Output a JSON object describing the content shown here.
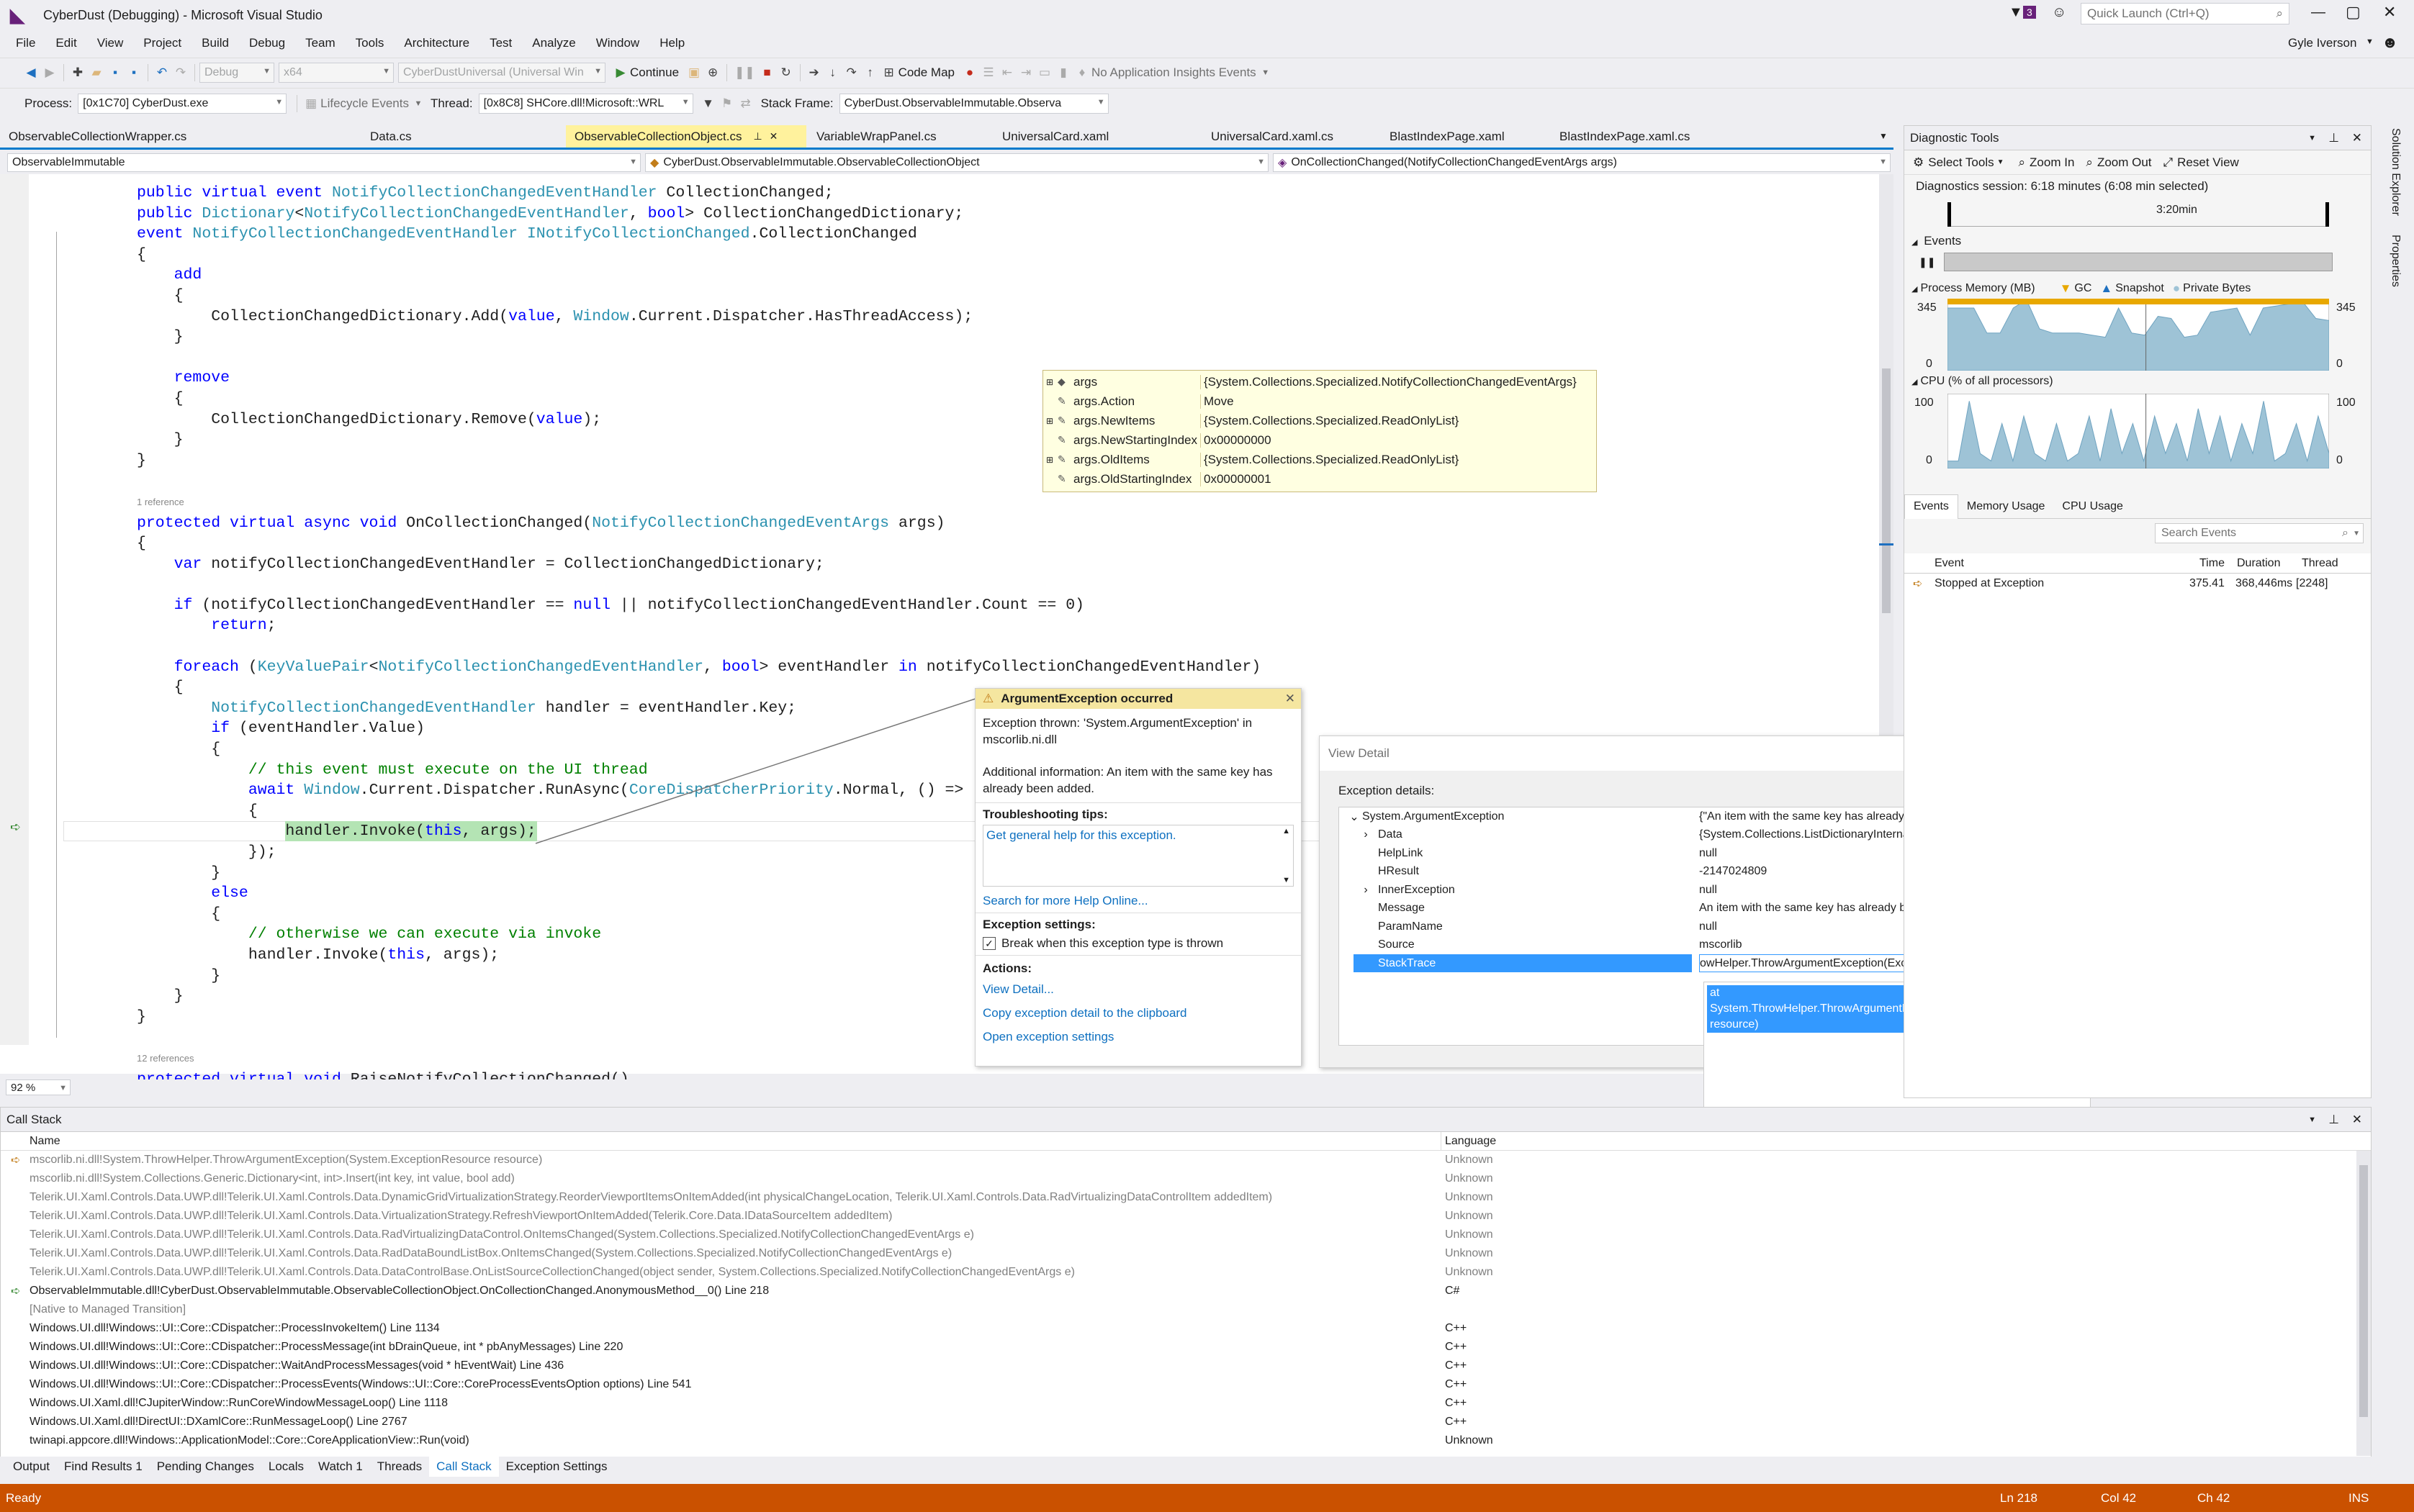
{
  "window": {
    "title": "CyberDust (Debugging) - Microsoft Visual Studio",
    "notifications": "3",
    "quick_launch": "Quick Launch (Ctrl+Q)",
    "user": "Gyle Iverson"
  },
  "menu": [
    "File",
    "Edit",
    "View",
    "Project",
    "Build",
    "Debug",
    "Team",
    "Tools",
    "Architecture",
    "Test",
    "Analyze",
    "Window",
    "Help"
  ],
  "toolbar": {
    "config": "Debug",
    "platform": "x64",
    "startup": "CyberDustUniversal (Universal Win",
    "continue": "Continue",
    "codemap": "Code Map",
    "insights": "No Application Insights Events"
  },
  "debug_location": {
    "process_label": "Process:",
    "process": "[0x1C70] CyberDust.exe",
    "lifecycle": "Lifecycle Events",
    "thread_label": "Thread:",
    "thread": "[0x8C8] SHCore.dll!Microsoft::WRL",
    "stack_label": "Stack Frame:",
    "stack": "CyberDust.ObservableImmutable.Observa"
  },
  "tabs": [
    "ObservableCollectionWrapper.cs",
    "Data.cs",
    "ObservableCollectionObject.cs",
    "VariableWrapPanel.cs",
    "UniversalCard.xaml",
    "UniversalCard.xaml.cs",
    "BlastIndexPage.xaml",
    "BlastIndexPage.xaml.cs"
  ],
  "nav": {
    "project": "ObservableImmutable",
    "type": "CyberDust.ObservableImmutable.ObservableCollectionObject",
    "member": "OnCollectionChanged(NotifyCollectionChangedEventArgs args)"
  },
  "editor": {
    "zoom": "92 %",
    "ref1": "1 reference",
    "ref2": "12 references"
  },
  "datatip": [
    {
      "name": "args",
      "value": "{System.Collections.Specialized.NotifyCollectionChangedEventArgs}"
    },
    {
      "name": "args.Action",
      "value": "Move"
    },
    {
      "name": "args.NewItems",
      "value": "{System.Collections.Specialized.ReadOnlyList}"
    },
    {
      "name": "args.NewStartingIndex",
      "value": "0x00000000"
    },
    {
      "name": "args.OldItems",
      "value": "{System.Collections.Specialized.ReadOnlyList}"
    },
    {
      "name": "args.OldStartingIndex",
      "value": "0x00000001"
    }
  ],
  "exception": {
    "title": "ArgumentException occurred",
    "thrown": "Exception thrown: 'System.ArgumentException' in mscorlib.ni.dll",
    "info": "Additional information: An item with the same key has already been added.",
    "tips_title": "Troubleshooting tips:",
    "tip": "Get general help for this exception.",
    "search": "Search for more Help Online...",
    "settings_title": "Exception settings:",
    "break_when": "Break when this exception type is thrown",
    "actions_title": "Actions:",
    "view_detail": "View Detail...",
    "copy": "Copy exception detail to the clipboard",
    "open_settings": "Open exception settings"
  },
  "view_detail": {
    "title": "View Detail",
    "help": "?",
    "close": "✕",
    "label": "Exception details:",
    "rows": [
      {
        "name": "System.ArgumentException",
        "value": "{\"An item with the same key has already been added.\"}"
      },
      {
        "name": "Data",
        "value": "{System.Collections.ListDictionaryInternal}"
      },
      {
        "name": "HelpLink",
        "value": "null"
      },
      {
        "name": "HResult",
        "value": "-2147024809"
      },
      {
        "name": "InnerException",
        "value": "null"
      },
      {
        "name": "Message",
        "value": "An item with the same key has already been added."
      },
      {
        "name": "ParamName",
        "value": "null"
      },
      {
        "name": "Source",
        "value": "mscorlib"
      },
      {
        "name": "StackTrace",
        "value": "owHelper.ThrowArgumentException(ExceptionResource resource)"
      }
    ],
    "stacktrace_popup": "   at System.ThrowHelper.ThrowArgumentException(ExceptionResource resource)"
  },
  "diag": {
    "title": "Diagnostic Tools",
    "select_tools": "Select Tools",
    "zoom_in": "Zoom In",
    "zoom_out": "Zoom Out",
    "reset_view": "Reset View",
    "session": "Diagnostics session: 6:18 minutes (6:08 min selected)",
    "ruler": "3:20min",
    "events": "Events",
    "memory": "Process Memory (MB)",
    "gc": "GC",
    "snapshot": "Snapshot",
    "private": "Private Bytes",
    "mem_max": "345",
    "mem_min": "0",
    "cpu": "CPU (% of all processors)",
    "cpu_max": "100",
    "cpu_min": "0",
    "tabs": [
      "Events",
      "Memory Usage",
      "CPU Usage"
    ],
    "search": "Search Events",
    "cols": [
      "Event",
      "Time",
      "Duration",
      "Thread"
    ],
    "event": {
      "name": "Stopped at Exception",
      "time": "375.41",
      "duration": "368,446ms",
      "thread": "[2248]"
    },
    "memory_series": [
      300,
      300,
      300,
      180,
      180,
      300,
      340,
      200,
      180,
      180,
      180,
      170,
      160,
      300,
      180,
      170,
      260,
      250,
      160,
      170,
      280,
      290,
      300,
      170,
      300,
      310,
      320,
      330,
      250,
      240
    ],
    "cpu_series": [
      10,
      10,
      90,
      20,
      10,
      60,
      10,
      70,
      20,
      10,
      60,
      10,
      20,
      70,
      10,
      80,
      20,
      60,
      10,
      70,
      20,
      60,
      10,
      80,
      20,
      70,
      10,
      60,
      20,
      90,
      10,
      20,
      60,
      10,
      70,
      20
    ]
  },
  "callstack": {
    "title": "Call Stack",
    "col_name": "Name",
    "col_lang": "Language",
    "rows": [
      {
        "name": "mscorlib.ni.dll!System.ThrowHelper.ThrowArgumentException(System.ExceptionResource resource)",
        "lang": "Unknown",
        "gray": true
      },
      {
        "name": "mscorlib.ni.dll!System.Collections.Generic.Dictionary<int, int>.Insert(int key, int value, bool add)",
        "lang": "Unknown",
        "gray": true
      },
      {
        "name": "Telerik.UI.Xaml.Controls.Data.UWP.dll!Telerik.UI.Xaml.Controls.Data.DynamicGridVirtualizationStrategy.ReorderViewportItemsOnItemAdded(int physicalChangeLocation, Telerik.UI.Xaml.Controls.Data.RadVirtualizingDataControlItem addedItem)",
        "lang": "Unknown",
        "gray": true
      },
      {
        "name": "Telerik.UI.Xaml.Controls.Data.UWP.dll!Telerik.UI.Xaml.Controls.Data.VirtualizationStrategy.RefreshViewportOnItemAdded(Telerik.Core.Data.IDataSourceItem addedItem)",
        "lang": "Unknown",
        "gray": true
      },
      {
        "name": "Telerik.UI.Xaml.Controls.Data.UWP.dll!Telerik.UI.Xaml.Controls.Data.RadVirtualizingDataControl.OnItemsChanged(System.Collections.Specialized.NotifyCollectionChangedEventArgs e)",
        "lang": "Unknown",
        "gray": true
      },
      {
        "name": "Telerik.UI.Xaml.Controls.Data.UWP.dll!Telerik.UI.Xaml.Controls.Data.RadDataBoundListBox.OnItemsChanged(System.Collections.Specialized.NotifyCollectionChangedEventArgs e)",
        "lang": "Unknown",
        "gray": true
      },
      {
        "name": "Telerik.UI.Xaml.Controls.Data.UWP.dll!Telerik.UI.Xaml.Controls.Data.DataControlBase.OnListSourceCollectionChanged(object sender, System.Collections.Specialized.NotifyCollectionChangedEventArgs e)",
        "lang": "Unknown",
        "gray": true
      },
      {
        "name": "ObservableImmutable.dll!CyberDust.ObservableImmutable.ObservableCollectionObject.OnCollectionChanged.AnonymousMethod__0() Line 218",
        "lang": "C#",
        "gray": false
      },
      {
        "name": "[Native to Managed Transition]",
        "lang": "",
        "gray": true
      },
      {
        "name": "Windows.UI.dll!Windows::UI::Core::CDispatcher::ProcessInvokeItem() Line 1134",
        "lang": "C++",
        "gray": false
      },
      {
        "name": "Windows.UI.dll!Windows::UI::Core::CDispatcher::ProcessMessage(int bDrainQueue, int * pbAnyMessages) Line 220",
        "lang": "C++",
        "gray": false
      },
      {
        "name": "Windows.UI.dll!Windows::UI::Core::CDispatcher::WaitAndProcessMessages(void * hEventWait) Line 436",
        "lang": "C++",
        "gray": false
      },
      {
        "name": "Windows.UI.dll!Windows::UI::Core::CDispatcher::ProcessEvents(Windows::UI::Core::CoreProcessEventsOption options) Line 541",
        "lang": "C++",
        "gray": false
      },
      {
        "name": "Windows.UI.Xaml.dll!CJupiterWindow::RunCoreWindowMessageLoop() Line 1118",
        "lang": "C++",
        "gray": false
      },
      {
        "name": "Windows.UI.Xaml.dll!DirectUI::DXamlCore::RunMessageLoop() Line 2767",
        "lang": "C++",
        "gray": false
      },
      {
        "name": "twinapi.appcore.dll!Windows::ApplicationModel::Core::CoreApplicationView::Run(void)",
        "lang": "Unknown",
        "gray": false
      }
    ]
  },
  "bottom_tabs": [
    "Output",
    "Find Results 1",
    "Pending Changes",
    "Locals",
    "Watch 1",
    "Threads",
    "Call Stack",
    "Exception Settings"
  ],
  "side_tabs": [
    "Solution Explorer",
    "Properties"
  ],
  "status": {
    "ready": "Ready",
    "ln": "Ln 218",
    "col": "Col 42",
    "ch": "Ch 42",
    "ins": "INS"
  },
  "colors": {
    "accent": "#007acc",
    "status": "#ca5100",
    "active_tab": "#fff29d",
    "datatip": "#ffffe1",
    "chart": "#9ec3d6"
  }
}
